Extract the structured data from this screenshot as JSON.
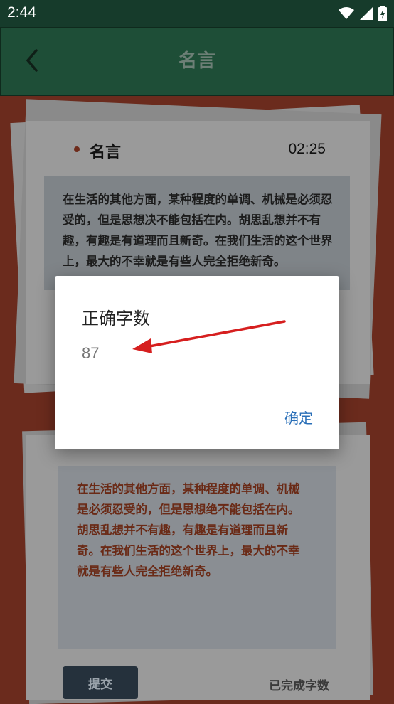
{
  "status_bar": {
    "time": "2:44"
  },
  "toolbar": {
    "title": "名言",
    "back_icon": "chevron-left-icon"
  },
  "card": {
    "title": "名言",
    "timer": "02:25",
    "quote": "在生活的其他方面，某种程度的单调、机械是必须忍受的，但是思想决不能包括在内。胡思乱想并不有趣，有趣是有道理而且新奇。在我们生活的这个世界上，最大的不幸就是有些人完全拒绝新奇。"
  },
  "input": {
    "value": "在生活的其他方面，某种程度的单调、机械是必须忍受的，但是思想绝不能包括在内。胡思乱想并不有趣，有趣是有道理而且新奇。在我们生活的这个世界上，最大的不幸就是有些人完全拒绝新奇。"
  },
  "footer": {
    "submit_label": "提交",
    "progress_label": "已完成字数"
  },
  "dialog": {
    "title": "正确字数",
    "message": "87",
    "confirm_label": "确定"
  },
  "colors": {
    "toolbar": "#1e4e37",
    "accent": "#2a6fb8",
    "background": "#6b2c1e",
    "annotation_arrow": "#d61f1f"
  }
}
